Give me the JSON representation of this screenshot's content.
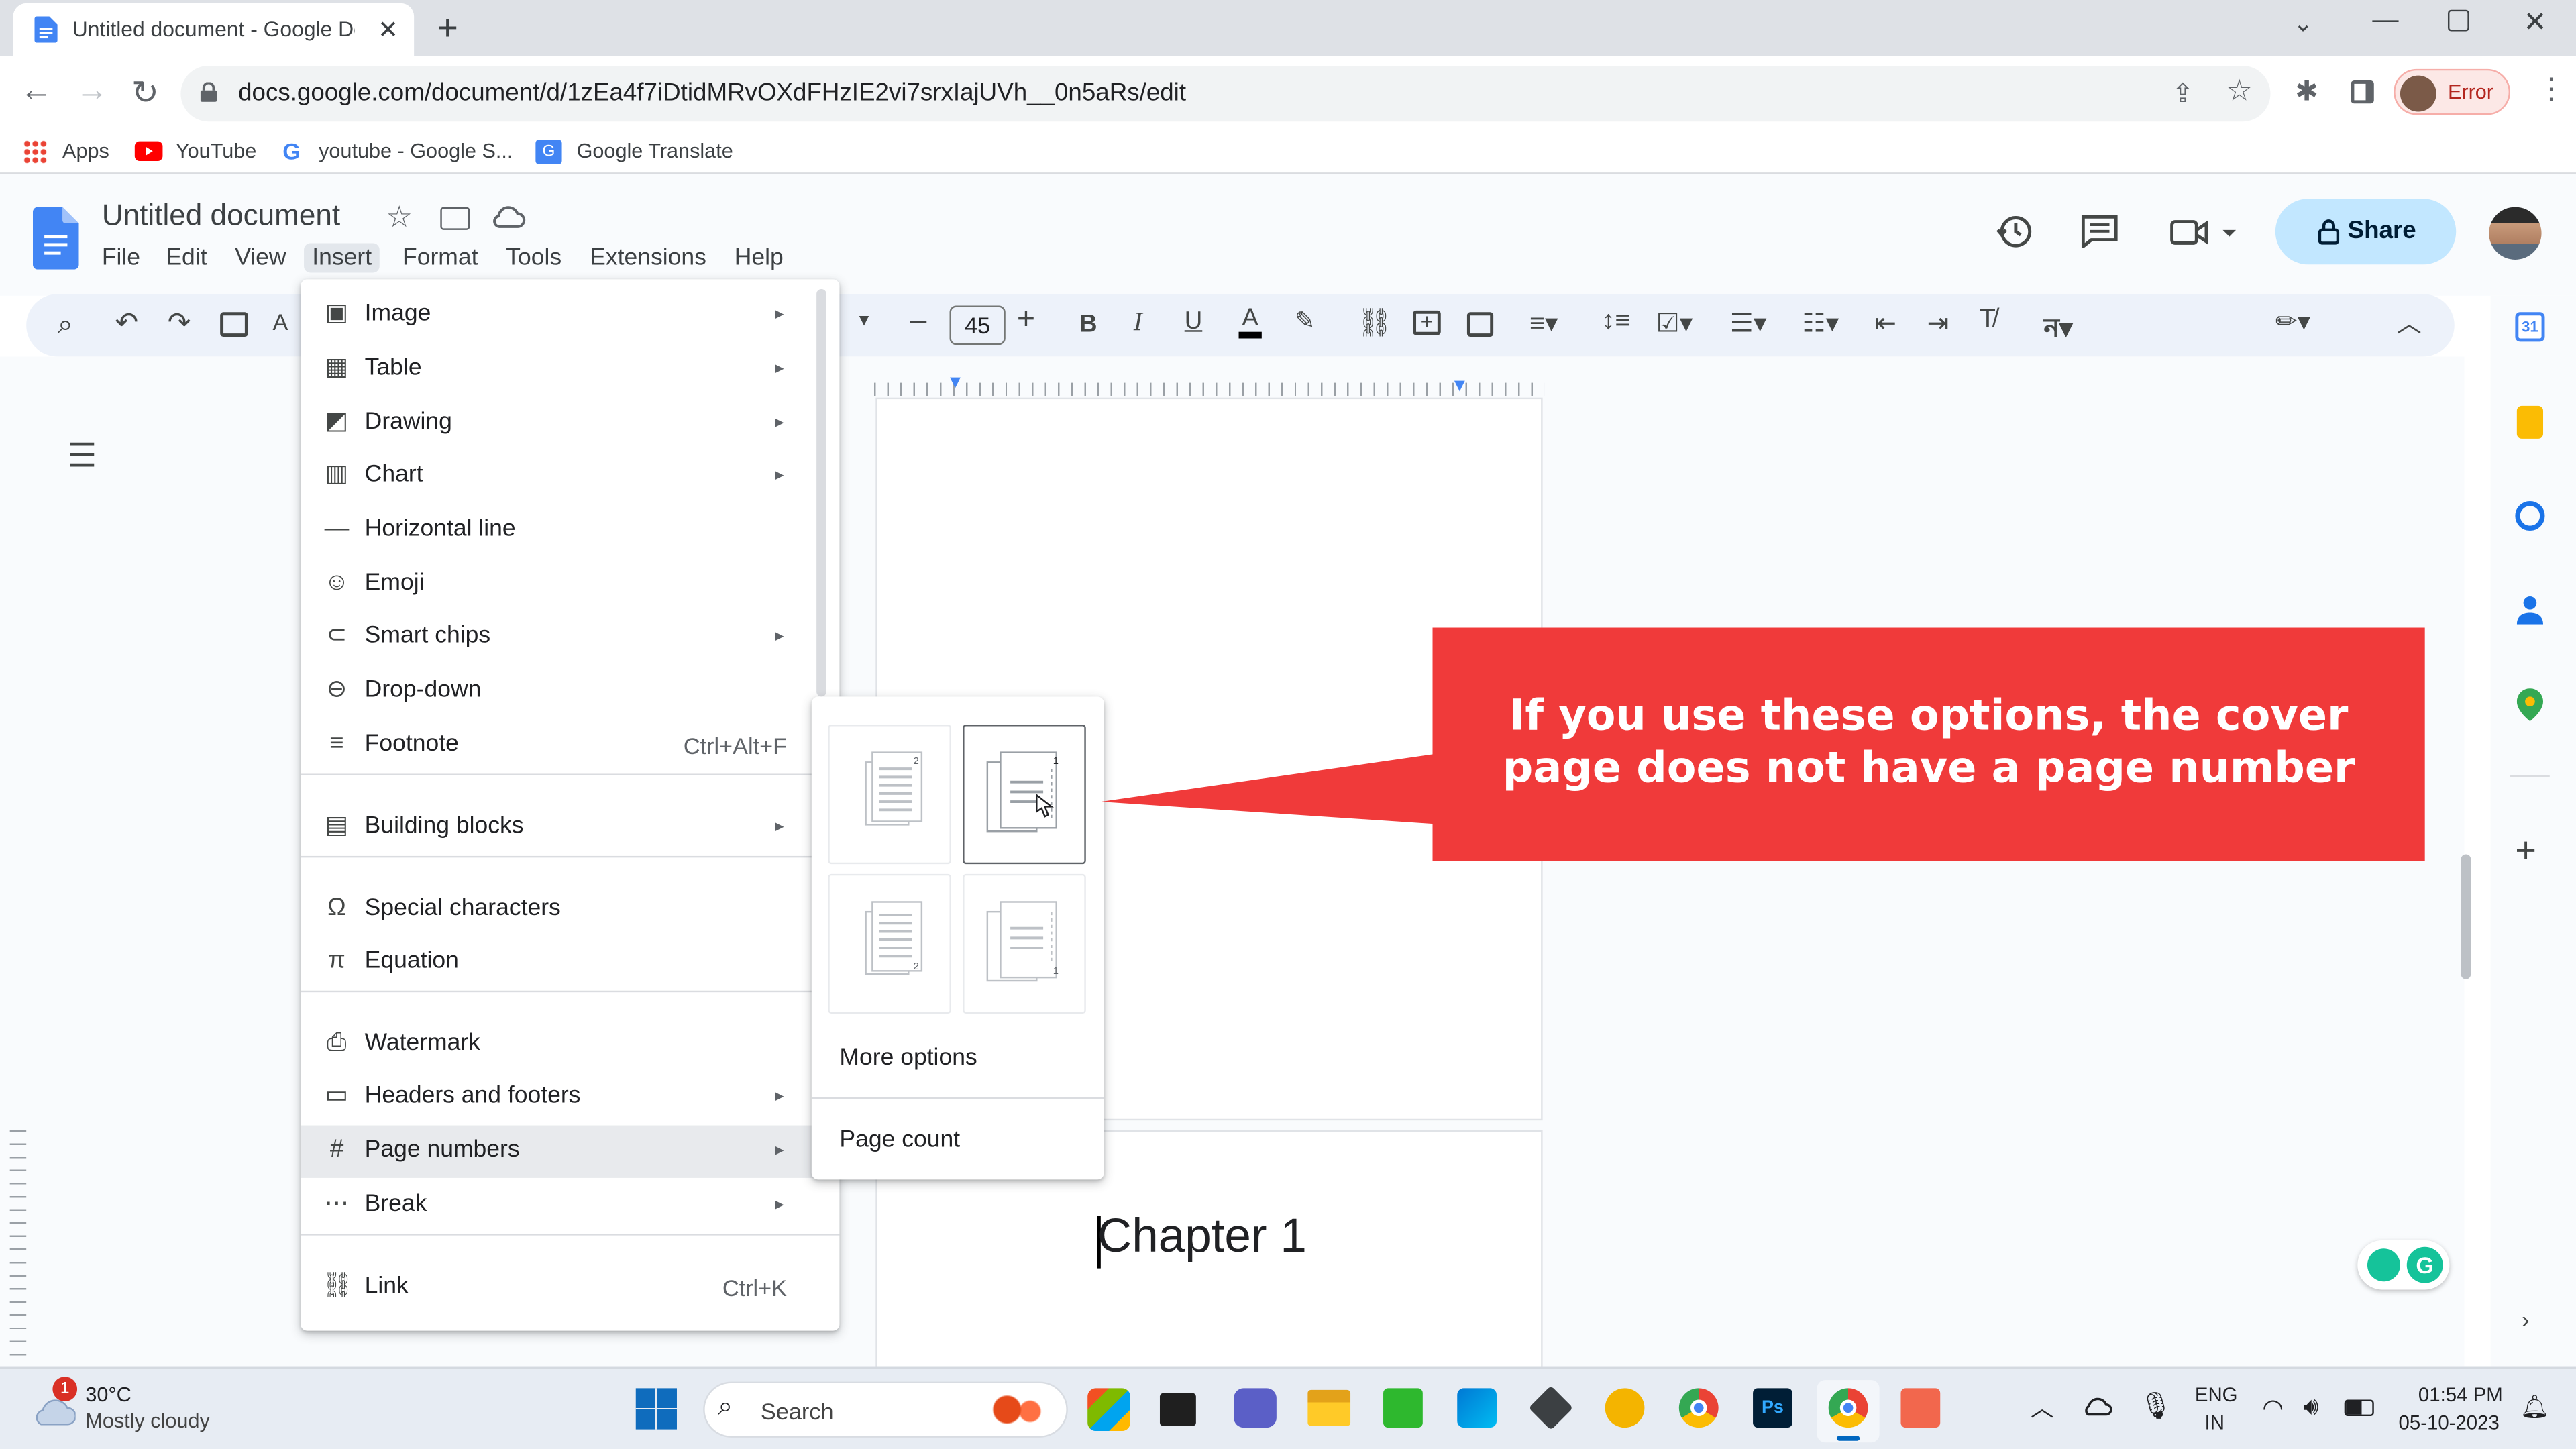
{
  "browser": {
    "tab_title": "Untitled document - Google Do",
    "url": "docs.google.com/document/d/1zEa4f7iDtidMRvOXdFHzIE2vi7srxIajUVh__0n5aRs/edit",
    "profile_status": "Error"
  },
  "bookmarks": [
    {
      "label": "Apps",
      "icon": "apps-grid-icon"
    },
    {
      "label": "YouTube",
      "icon": "youtube-icon"
    },
    {
      "label": "youtube - Google S...",
      "icon": "google-icon"
    },
    {
      "label": "Google Translate",
      "icon": "translate-icon"
    }
  ],
  "docs": {
    "title": "Untitled document",
    "menus": [
      "File",
      "Edit",
      "View",
      "Insert",
      "Format",
      "Tools",
      "Extensions",
      "Help"
    ],
    "font_size": "45",
    "share_label": "Share",
    "page_text": "Chapter 1"
  },
  "insert_menu": {
    "items": [
      {
        "label": "Image",
        "icon": "image-icon",
        "submenu": true
      },
      {
        "label": "Table",
        "icon": "table-icon",
        "submenu": true
      },
      {
        "label": "Drawing",
        "icon": "drawing-icon",
        "submenu": true
      },
      {
        "label": "Chart",
        "icon": "chart-icon",
        "submenu": true
      },
      {
        "label": "Horizontal line",
        "icon": "horizontal-line-icon"
      },
      {
        "label": "Emoji",
        "icon": "emoji-icon"
      },
      {
        "label": "Smart chips",
        "icon": "smart-chips-icon",
        "submenu": true
      },
      {
        "label": "Drop-down",
        "icon": "dropdown-icon"
      },
      {
        "label": "Footnote",
        "icon": "footnote-icon",
        "shortcut": "Ctrl+Alt+F"
      },
      {
        "label": "Building blocks",
        "icon": "building-blocks-icon",
        "submenu": true
      },
      {
        "label": "Special characters",
        "icon": "omega-icon"
      },
      {
        "label": "Equation",
        "icon": "pi-icon"
      },
      {
        "label": "Watermark",
        "icon": "watermark-icon"
      },
      {
        "label": "Headers and footers",
        "icon": "headers-footers-icon",
        "submenu": true
      },
      {
        "label": "Page numbers",
        "icon": "hash-icon",
        "submenu": true,
        "highlighted": true
      },
      {
        "label": "Break",
        "icon": "break-icon",
        "submenu": true
      },
      {
        "label": "Link",
        "icon": "link-icon",
        "shortcut": "Ctrl+K"
      }
    ]
  },
  "page_numbers_submenu": {
    "more_options": "More options",
    "page_count": "Page count"
  },
  "callout": {
    "text": "If you use these options, the cover page does not have a page number",
    "color": "#f03a3a"
  },
  "taskbar": {
    "weather_temp": "30°C",
    "weather_desc": "Mostly cloudy",
    "weather_badge": "1",
    "search_placeholder": "Search",
    "lang_primary": "ENG",
    "lang_secondary": "IN",
    "time": "01:54 PM",
    "date": "05-10-2023"
  },
  "colors": {
    "docs_blue": "#4285f4",
    "share_bg": "#c2e7ff",
    "chrome_bg": "#dee1e6"
  }
}
